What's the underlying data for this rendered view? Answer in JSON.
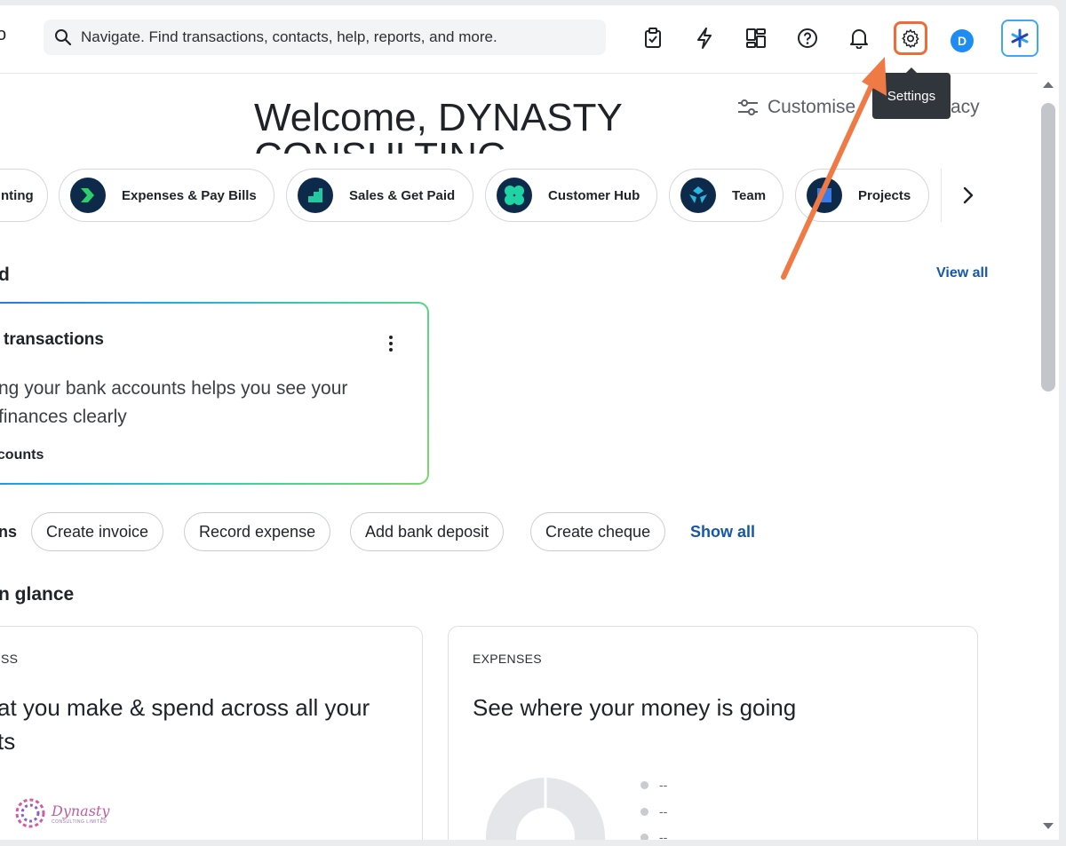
{
  "topbar": {
    "logo_fragment": "o",
    "search_placeholder": "Navigate. Find transactions, contacts, help, reports, and more.",
    "avatar_initial": "D",
    "tooltip": "Settings"
  },
  "welcome": {
    "title": "Welcome, DYNASTY",
    "title_line2": "CONSULTING",
    "customise": "Customise",
    "privacy_fragment": "acy"
  },
  "pills": [
    {
      "label": "nting",
      "icon": "accounting-icon"
    },
    {
      "label": "Expenses & Pay Bills",
      "icon": "expenses-icon"
    },
    {
      "label": "Sales & Get Paid",
      "icon": "sales-icon"
    },
    {
      "label": "Customer Hub",
      "icon": "customer-hub-icon"
    },
    {
      "label": "Team",
      "icon": "team-icon"
    },
    {
      "label": "Projects",
      "icon": "projects-icon"
    }
  ],
  "section": {
    "title_fragment": "d",
    "view_all": "View all"
  },
  "bank_card": {
    "title": "transactions",
    "body": "ng your bank accounts helps you see your finances clearly",
    "body_line1": "ng your bank accounts helps you see your",
    "body_line2": "finances clearly",
    "link": "ccounts"
  },
  "actions": {
    "label_fragment": "ns",
    "buttons": [
      "Create invoice",
      "Record expense",
      "Add bank deposit",
      "Create cheque"
    ],
    "show_all": "Show all"
  },
  "glance": {
    "title": "n glance",
    "left_card": {
      "eyebrow": "SS",
      "head_line1": "at you make & spend across all your",
      "head_line2": "ts"
    },
    "expenses_card": {
      "eyebrow": "EXPENSES",
      "head": "See where your money is going",
      "legend": [
        "--",
        "--",
        "--"
      ]
    }
  },
  "watermark": {
    "text": "Dynasty",
    "subtext": "CONSULTING LIMITED"
  },
  "colors": {
    "accent_blue": "#1558a8",
    "highlight_orange": "#f06b3b",
    "pill_icon_bg": "#0d2a4b",
    "tooltip_bg": "#30363c"
  }
}
